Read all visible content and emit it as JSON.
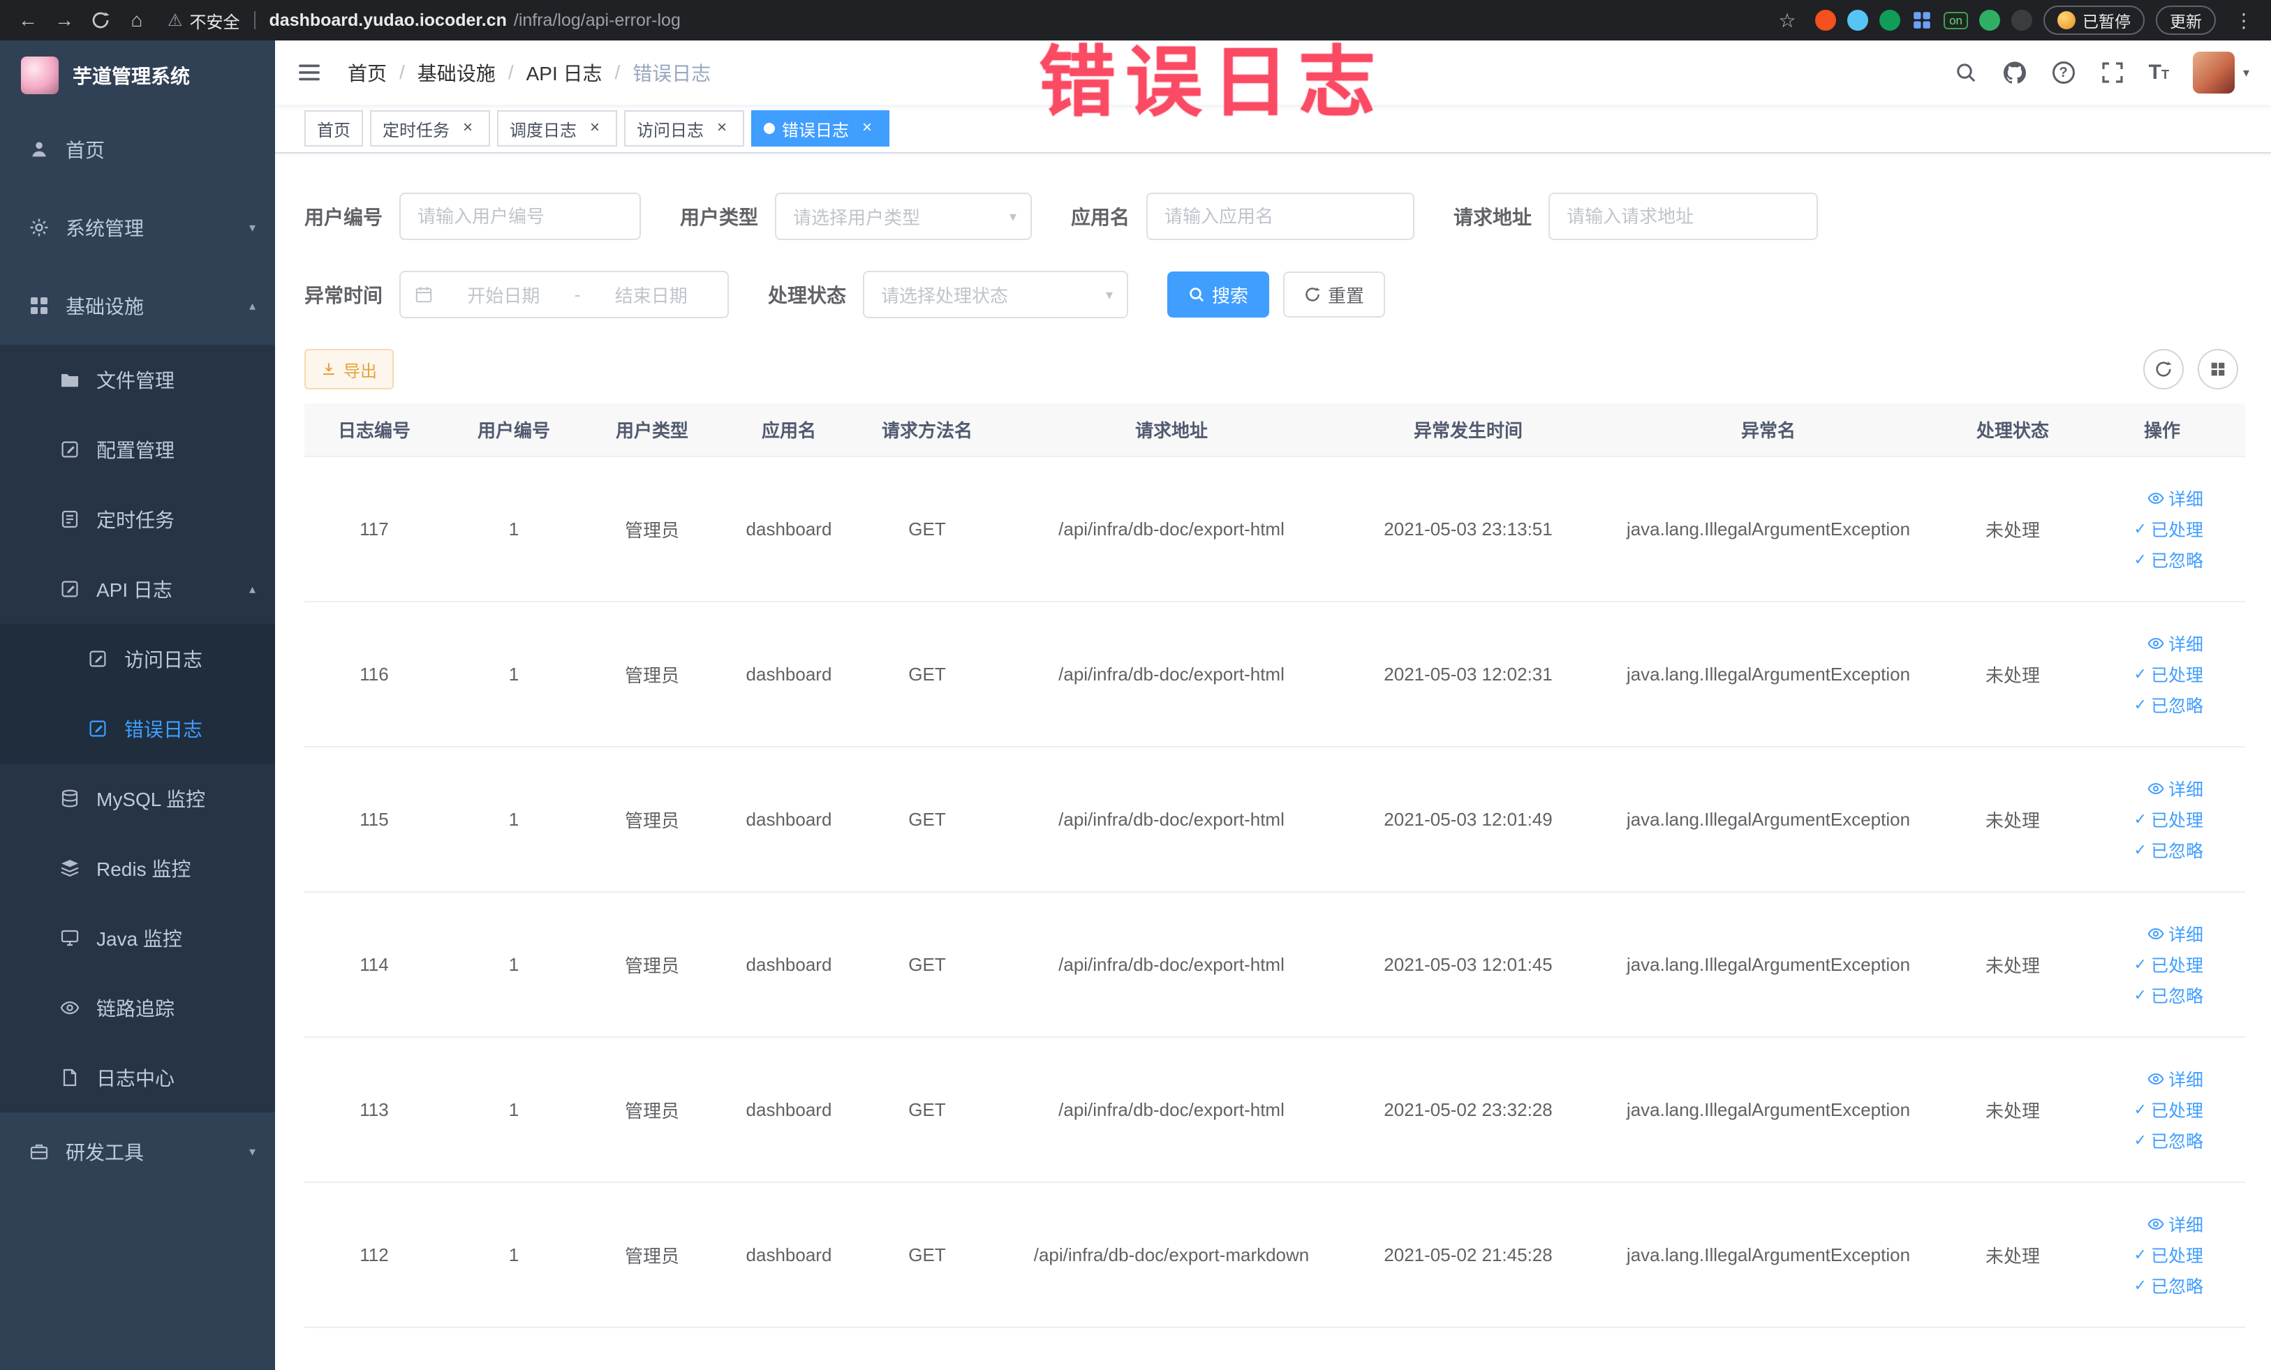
{
  "annotation": {
    "text": "错误日志",
    "color": "#fb4a63"
  },
  "glyphs": {
    "back": "←",
    "forward": "→",
    "home": "⌂",
    "warning": "⚠",
    "star": "☆",
    "kebab": "⋮",
    "close": "×",
    "caret_down": "▾",
    "caret_up": "▴",
    "check": "✓",
    "slash": "/",
    "big_t": "T",
    "small_t": "T",
    "question": "?"
  },
  "browser": {
    "security_label": "不安全",
    "url_host": "dashboard.yudao.iocoder.cn",
    "url_path": "/infra/log/api-error-log",
    "paused_label": "已暂停",
    "update_label": "更新",
    "ext_badge_on": "on"
  },
  "sidebar": {
    "logo_title": "芋道管理系统",
    "items": {
      "home": "首页",
      "system": "系统管理",
      "infra": "基础设施",
      "file": "文件管理",
      "config": "配置管理",
      "job": "定时任务",
      "api_log": "API 日志",
      "access_log": "访问日志",
      "error_log": "错误日志",
      "mysql": "MySQL 监控",
      "redis": "Redis 监控",
      "java": "Java 监控",
      "trace": "链路追踪",
      "log_center": "日志中心",
      "dev_tools": "研发工具"
    }
  },
  "breadcrumb": {
    "items": [
      "首页",
      "基础设施",
      "API 日志",
      "错误日志"
    ]
  },
  "tabs": [
    {
      "label": "首页"
    },
    {
      "label": "定时任务"
    },
    {
      "label": "调度日志"
    },
    {
      "label": "访问日志"
    },
    {
      "label": "错误日志"
    }
  ],
  "filters": {
    "user_id_label": "用户编号",
    "user_id_placeholder": "请输入用户编号",
    "user_type_label": "用户类型",
    "user_type_placeholder": "请选择用户类型",
    "app_name_label": "应用名",
    "app_name_placeholder": "请输入应用名",
    "request_url_label": "请求地址",
    "request_url_placeholder": "请输入请求地址",
    "exception_time_label": "异常时间",
    "start_date_placeholder": "开始日期",
    "end_date_placeholder": "结束日期",
    "range_separator": "-",
    "process_status_label": "处理状态",
    "process_status_placeholder": "请选择处理状态",
    "search_label": "搜索",
    "reset_label": "重置"
  },
  "toolbar": {
    "export_label": "导出"
  },
  "table": {
    "columns": [
      "日志编号",
      "用户编号",
      "用户类型",
      "应用名",
      "请求方法名",
      "请求地址",
      "异常发生时间",
      "异常名",
      "处理状态",
      "操作"
    ],
    "row_actions": [
      "详细",
      "已处理",
      "已忽略"
    ],
    "rows": [
      {
        "id": "117",
        "user_id": "1",
        "user_type": "管理员",
        "app": "dashboard",
        "method": "GET",
        "url": "/api/infra/db-doc/export-html",
        "time": "2021-05-03 23:13:51",
        "exception": "java.lang.IllegalArgumentException",
        "status": "未处理"
      },
      {
        "id": "116",
        "user_id": "1",
        "user_type": "管理员",
        "app": "dashboard",
        "method": "GET",
        "url": "/api/infra/db-doc/export-html",
        "time": "2021-05-03 12:02:31",
        "exception": "java.lang.IllegalArgumentException",
        "status": "未处理"
      },
      {
        "id": "115",
        "user_id": "1",
        "user_type": "管理员",
        "app": "dashboard",
        "method": "GET",
        "url": "/api/infra/db-doc/export-html",
        "time": "2021-05-03 12:01:49",
        "exception": "java.lang.IllegalArgumentException",
        "status": "未处理"
      },
      {
        "id": "114",
        "user_id": "1",
        "user_type": "管理员",
        "app": "dashboard",
        "method": "GET",
        "url": "/api/infra/db-doc/export-html",
        "time": "2021-05-03 12:01:45",
        "exception": "java.lang.IllegalArgumentException",
        "status": "未处理"
      },
      {
        "id": "113",
        "user_id": "1",
        "user_type": "管理员",
        "app": "dashboard",
        "method": "GET",
        "url": "/api/infra/db-doc/export-html",
        "time": "2021-05-02 23:32:28",
        "exception": "java.lang.IllegalArgumentException",
        "status": "未处理"
      },
      {
        "id": "112",
        "user_id": "1",
        "user_type": "管理员",
        "app": "dashboard",
        "method": "GET",
        "url": "/api/infra/db-doc/export-markdown",
        "time": "2021-05-02 21:45:28",
        "exception": "java.lang.IllegalArgumentException",
        "status": "未处理"
      }
    ]
  },
  "colors": {
    "accent": "#409EFF",
    "warning": "#e6a23c",
    "sidebar_bg": "#304156",
    "annotation": "#fb4a63"
  }
}
